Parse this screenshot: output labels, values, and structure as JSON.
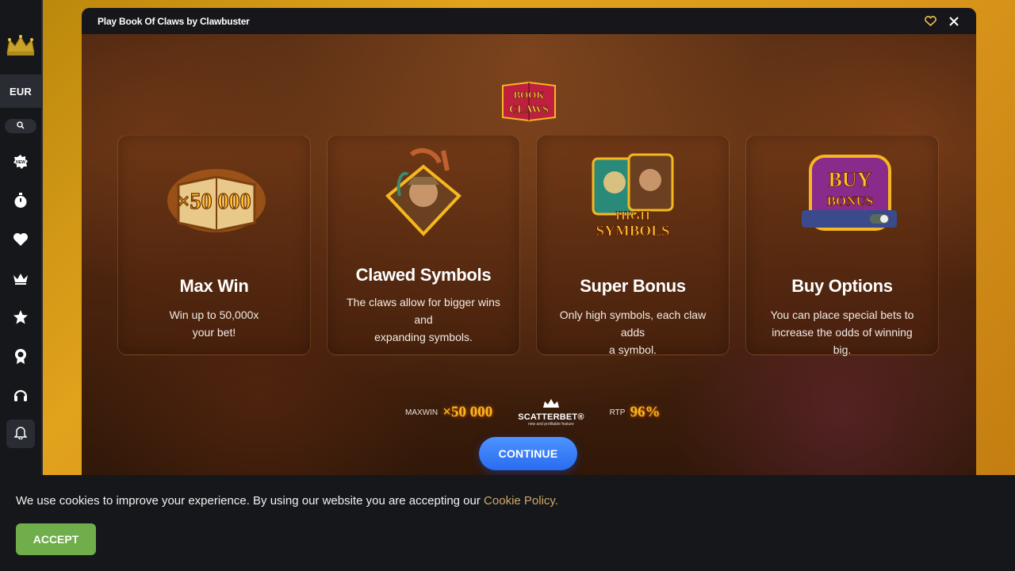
{
  "sidebar": {
    "currency": "EUR",
    "icons": [
      "new-badge-icon",
      "stopwatch-icon",
      "heart-icon",
      "crown-icon",
      "star-icon",
      "medal-icon",
      "headset-icon"
    ]
  },
  "modal": {
    "title": "Play Book Of Claws by Clawbuster",
    "cards": [
      {
        "title": "Max Win",
        "desc_lines": [
          "Win up to 50,000x",
          "your bet!"
        ]
      },
      {
        "title": "Clawed Symbols",
        "desc_lines": [
          "The claws allow for bigger wins",
          "and",
          "expanding symbols."
        ]
      },
      {
        "title": "Super Bonus",
        "desc_lines": [
          "Only high symbols, each claw adds",
          "a symbol."
        ]
      },
      {
        "title": "Buy Options",
        "desc_lines": [
          "You can place special bets to",
          "increase the odds of winning big."
        ]
      }
    ],
    "art_text": {
      "max_win": "×50 000",
      "high_symbols_1": "HIGH",
      "high_symbols_2": "SYMBOLS",
      "buy_1": "BUY",
      "buy_2": "BONUS",
      "logo_1": "BOOK",
      "logo_2": "CLAWS"
    },
    "stats": {
      "maxwin_label": "MAXWIN",
      "maxwin_value": "×50 000",
      "scatterbet_name": "SCATTERBET®",
      "scatterbet_sub": "new and profitable feature",
      "rtp_label": "RTP",
      "rtp_value": "96%"
    },
    "continue_label": "CONTINUE"
  },
  "cookie": {
    "text": "We use cookies to improve your experience. By using our website you are accepting our ",
    "link": "Cookie Policy.",
    "accept_label": "ACCEPT"
  },
  "colors": {
    "accent_blue": "#2a6cf0",
    "accept_green": "#6fae4a",
    "gold": "#f5b820"
  }
}
